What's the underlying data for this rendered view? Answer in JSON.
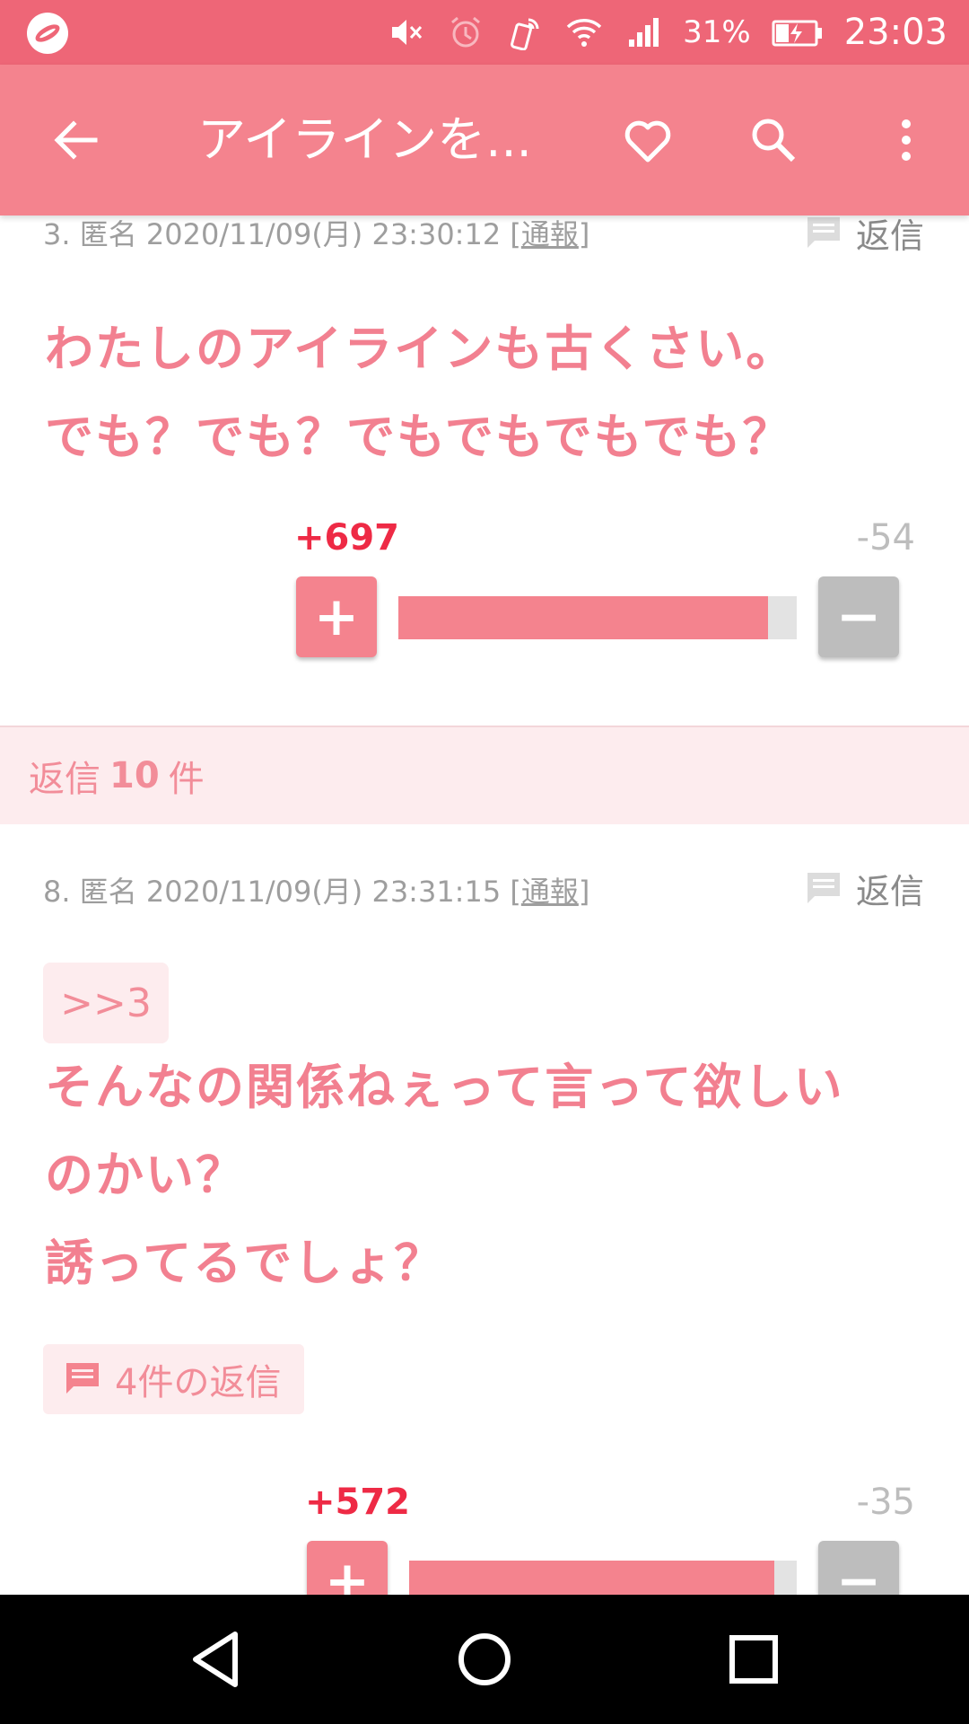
{
  "status_bar": {
    "battery_percent": "31%",
    "clock": "23:03",
    "icons": [
      "app-logo-icon",
      "mute-icon",
      "alarm-icon",
      "nfc-icon",
      "wifi-icon",
      "signal-icon",
      "battery-charging-icon"
    ]
  },
  "toolbar": {
    "title": "アイラインを...",
    "icons": [
      "back-arrow-icon",
      "heart-icon",
      "search-icon",
      "more-vert-icon"
    ]
  },
  "posts": [
    {
      "meta_prefix": "3. 匿名 2020/11/09(月) 23:30:12 [",
      "report_label": "通報",
      "meta_suffix": "]",
      "reply_label": "返信",
      "body_lines": [
        "わたしのアイラインも古くさい。",
        "でも？でも？でもでもでもでも？"
      ],
      "plus_votes": "+697",
      "minus_votes": "-54",
      "plus_button": "+",
      "minus_button": "−",
      "positive_ratio": 0.928
    },
    {
      "meta_prefix": "8. 匿名 2020/11/09(月) 23:31:15 [",
      "report_label": "通報",
      "meta_suffix": "]",
      "reply_label": "返信",
      "anchor": ">>3",
      "body_lines": [
        "そんなの関係ねぇって言って欲しい",
        "のかい？",
        "誘ってるでしょ？"
      ],
      "reply_count_label": "4件の返信",
      "plus_votes": "+572",
      "minus_votes": "-35",
      "plus_button": "+",
      "minus_button": "−",
      "positive_ratio": 0.942
    }
  ],
  "replies_band": {
    "prefix": "返信",
    "count": "10",
    "suffix": "件"
  },
  "colors": {
    "status_bar": "#ee6677",
    "toolbar": "#f4838e",
    "accent_text": "#f28090",
    "plus_count": "#ee2a45",
    "minus_gray": "#bdbdbd",
    "pink_background": "#fdecee"
  },
  "nav_bar": {
    "icons": [
      "back-triangle-icon",
      "home-circle-icon",
      "recents-square-icon"
    ]
  }
}
